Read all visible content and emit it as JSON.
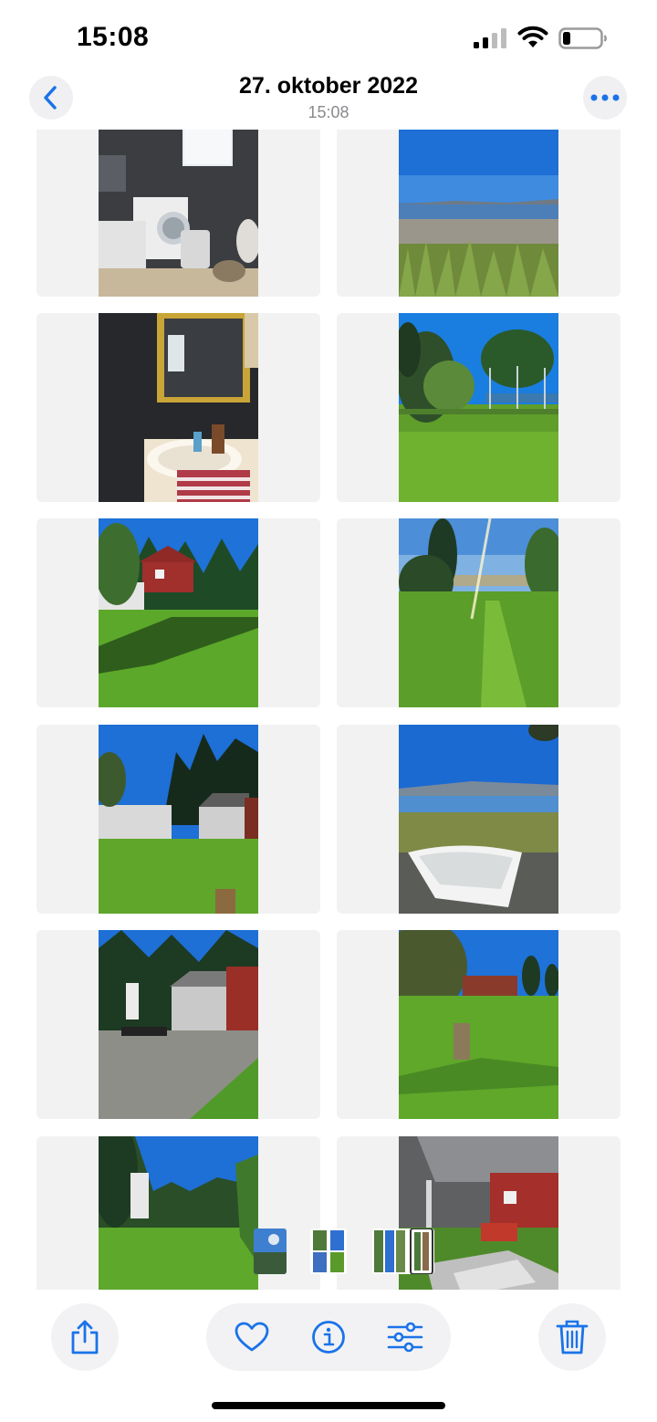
{
  "status": {
    "time": "15:08"
  },
  "header": {
    "title": "27. oktober 2022",
    "subtitle": "15:08"
  },
  "colors": {
    "accent": "#1a73e8",
    "cell_bg": "#f2f2f2",
    "button_bg": "#f2f2f4"
  },
  "icons": {
    "back": "chevron-left-icon",
    "more": "ellipsis-icon",
    "share": "share-icon",
    "favorite": "heart-icon",
    "info": "info-icon",
    "adjust": "sliders-icon",
    "delete": "trash-icon"
  },
  "photos": [
    {
      "subject": "laundry room"
    },
    {
      "subject": "sea shore"
    },
    {
      "subject": "bathroom mirror"
    },
    {
      "subject": "garden trampoline"
    },
    {
      "subject": "red cabin lawn"
    },
    {
      "subject": "lawn with sun"
    },
    {
      "subject": "houses and lawn"
    },
    {
      "subject": "boat by shore"
    },
    {
      "subject": "terrace with grill"
    },
    {
      "subject": "garden stump"
    },
    {
      "subject": "lawn and trees"
    },
    {
      "subject": "terrace chairs"
    }
  ]
}
